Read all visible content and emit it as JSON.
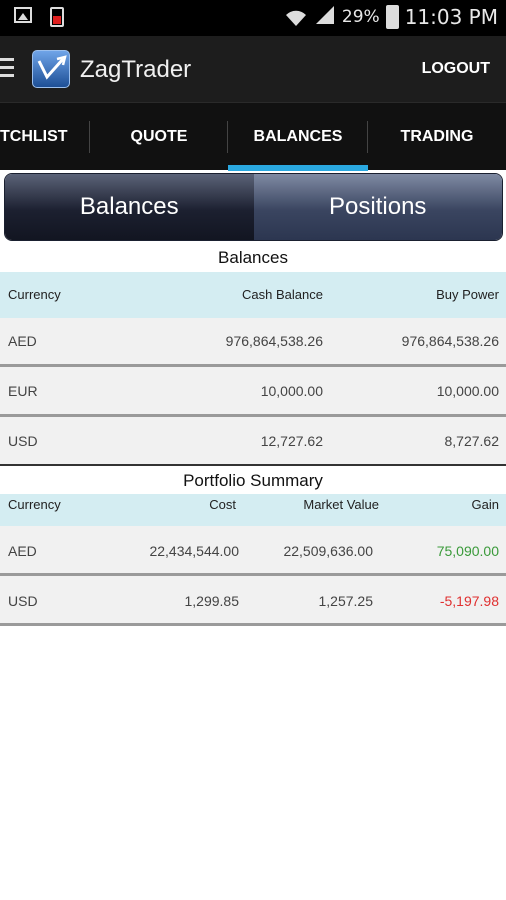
{
  "status": {
    "battery_pct": "29%",
    "time": "11:03 PM"
  },
  "app": {
    "title": "ZagTrader",
    "logout": "LOGOUT"
  },
  "tabs": [
    "TCHLIST",
    "QUOTE",
    "BALANCES",
    "TRADING"
  ],
  "active_tab": "BALANCES",
  "segment": {
    "balances": "Balances",
    "positions": "Positions"
  },
  "balances": {
    "title": "Balances",
    "headers": [
      "Currency",
      "Cash Balance",
      "Buy Power"
    ],
    "rows": [
      [
        "AED",
        "976,864,538.26",
        "976,864,538.26"
      ],
      [
        "EUR",
        "10,000.00",
        "10,000.00"
      ],
      [
        "USD",
        "12,727.62",
        "8,727.62"
      ]
    ]
  },
  "portfolio": {
    "title": "Portfolio Summary",
    "headers": [
      "Currency",
      "Cost",
      "Market Value",
      "Gain"
    ],
    "rows": [
      [
        "AED",
        "22,434,544.00",
        "22,509,636.00",
        "75,090.00"
      ],
      [
        "USD",
        "1,299.85",
        "1,257.25",
        "-5,197.98"
      ]
    ]
  },
  "colors": {
    "accent": "#2aa8e0",
    "gain_positive": "#3a9a3a",
    "gain_negative": "#e03030",
    "header_bg": "#d4edf2"
  }
}
